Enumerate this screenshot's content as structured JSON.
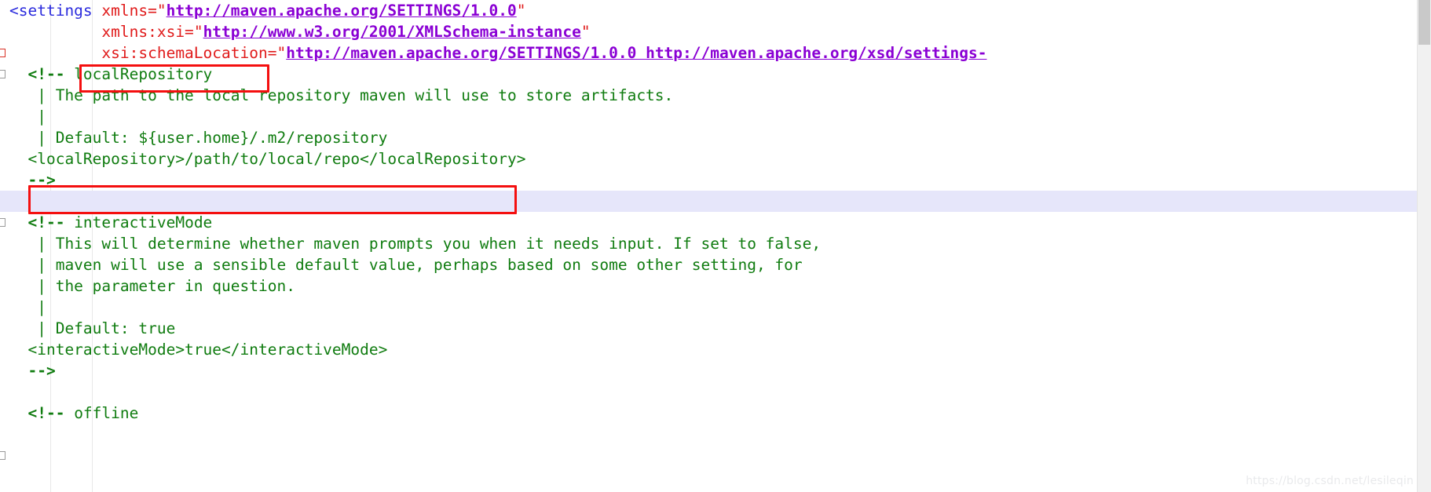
{
  "editor": {
    "file_kind": "maven-settings-xml",
    "colors": {
      "background": "#ffffff",
      "tag": "#2b2bdd",
      "attribute": "#e01b1b",
      "url": "#8a00d4",
      "comment": "#107c10",
      "annotation_box": "#f40f0f",
      "current_line_highlight": "#e6e6fa",
      "scrollbar_thumb": "#c9c9c9"
    },
    "lines": [
      {
        "n": 1,
        "parts": [
          {
            "t": "<settings ",
            "c": "tag"
          },
          {
            "t": "xmlns=",
            "c": "attr"
          },
          {
            "t": "\"",
            "c": "q"
          },
          {
            "t": "http://maven.apache.org/SETTINGS/1.0.0",
            "c": "url"
          },
          {
            "t": "\"",
            "c": "q"
          }
        ]
      },
      {
        "n": 2,
        "parts": [
          {
            "t": "          xmlns:xsi=",
            "c": "attr"
          },
          {
            "t": "\"",
            "c": "q"
          },
          {
            "t": "http://www.w3.org/2001/XMLSchema-instance",
            "c": "url"
          },
          {
            "t": "\"",
            "c": "q"
          }
        ]
      },
      {
        "n": 3,
        "parts": [
          {
            "t": "          xsi:schemaLocation=",
            "c": "attr"
          },
          {
            "t": "\"",
            "c": "q"
          },
          {
            "t": "http://maven.apache.org/SETTINGS/1.0.0 http://maven.apache.org/xsd/settings-",
            "c": "url"
          }
        ]
      },
      {
        "n": 4,
        "parts": [
          {
            "t": "  ",
            "c": "cmt"
          },
          {
            "t": "<!--",
            "c": "cmtd"
          },
          {
            "t": " localRepository",
            "c": "cmt"
          }
        ]
      },
      {
        "n": 5,
        "parts": [
          {
            "t": "   | The path to the local repository maven will use to store artifacts.",
            "c": "cmt"
          }
        ]
      },
      {
        "n": 6,
        "parts": [
          {
            "t": "   |",
            "c": "cmt"
          }
        ]
      },
      {
        "n": 7,
        "parts": [
          {
            "t": "   | Default: ${user.home}/.m2/repository",
            "c": "cmt"
          }
        ]
      },
      {
        "n": 8,
        "parts": [
          {
            "t": "  <localRepository>/path/to/local/repo</localRepository>",
            "c": "cmt"
          }
        ]
      },
      {
        "n": 9,
        "parts": [
          {
            "t": "  ",
            "c": "cmt"
          },
          {
            "t": "-->",
            "c": "cmtd"
          }
        ]
      },
      {
        "n": 10,
        "current": true,
        "parts": [
          {
            "t": "",
            "c": "cmt"
          }
        ]
      },
      {
        "n": 11,
        "parts": [
          {
            "t": "  ",
            "c": "cmt"
          },
          {
            "t": "<!--",
            "c": "cmtd"
          },
          {
            "t": " interactiveMode",
            "c": "cmt"
          }
        ]
      },
      {
        "n": 12,
        "parts": [
          {
            "t": "   | This will determine whether maven prompts you when it needs input. If set to false,",
            "c": "cmt"
          }
        ]
      },
      {
        "n": 13,
        "parts": [
          {
            "t": "   | maven will use a sensible default value, perhaps based on some other setting, for",
            "c": "cmt"
          }
        ]
      },
      {
        "n": 14,
        "parts": [
          {
            "t": "   | the parameter in question.",
            "c": "cmt"
          }
        ]
      },
      {
        "n": 15,
        "parts": [
          {
            "t": "   |",
            "c": "cmt"
          }
        ]
      },
      {
        "n": 16,
        "parts": [
          {
            "t": "   | Default: true",
            "c": "cmt"
          }
        ]
      },
      {
        "n": 17,
        "parts": [
          {
            "t": "  <interactiveMode>true</interactiveMode>",
            "c": "cmt"
          }
        ]
      },
      {
        "n": 18,
        "parts": [
          {
            "t": "  ",
            "c": "cmt"
          },
          {
            "t": "-->",
            "c": "cmtd"
          }
        ]
      },
      {
        "n": 19,
        "parts": [
          {
            "t": "",
            "c": "cmt"
          }
        ]
      },
      {
        "n": 20,
        "parts": [
          {
            "t": "  ",
            "c": "cmt"
          },
          {
            "t": "<!--",
            "c": "cmtd"
          },
          {
            "t": " offline",
            "c": "cmt"
          }
        ]
      }
    ],
    "annotations": [
      {
        "name": "localrepository-highlight-box",
        "target": "localRepository"
      },
      {
        "name": "blank-line-highlight-box",
        "target": ""
      }
    ],
    "watermark": "https://blog.csdn.net/lesileqin"
  }
}
